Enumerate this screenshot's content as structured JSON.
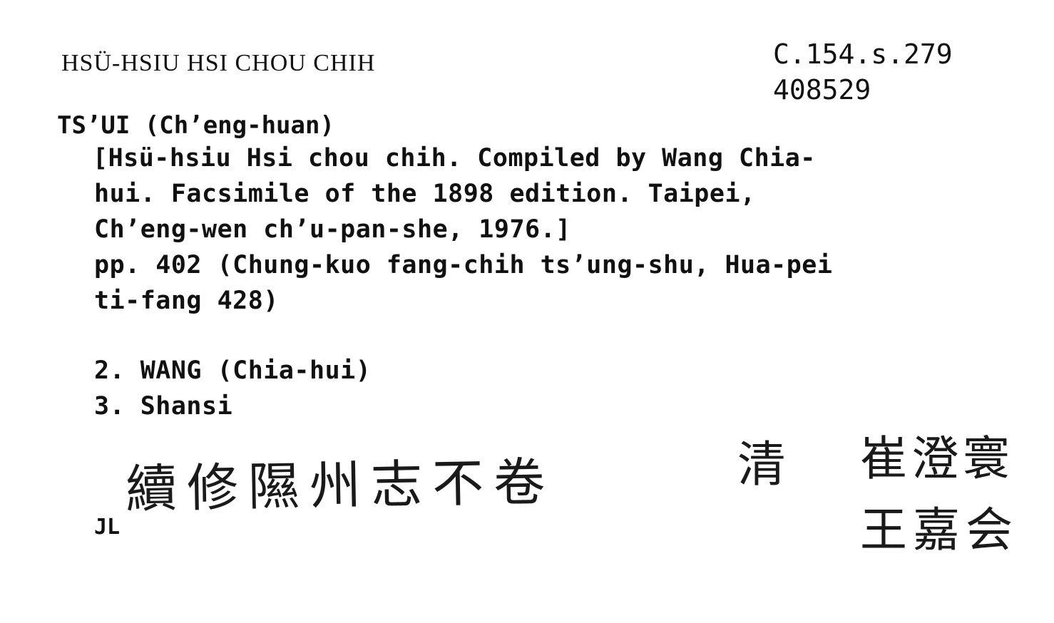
{
  "card": {
    "heading": "HSÜ-HSIU HSI CHOU CHIH",
    "shelfmark": "C.154.s.279",
    "accession": "408529",
    "author": "TS’UI (Ch’eng-huan)",
    "lines": [
      "[Hsü-hsiu Hsi chou chih. Compiled by Wang Chia-",
      "hui. Facsimile of the 1898 edition.  Taipei,",
      "Ch’eng-wen ch’u-pan-she, 1976.]",
      "pp. 402 (Chung-kuo fang-chih ts’ung-shu, Hua-pei",
      "ti-fang 428)"
    ],
    "added_entries": [
      "2. WANG (Chia-hui)",
      "3. Shansi"
    ],
    "initials": "JL"
  },
  "handwriting": {
    "title": "續修隰州志不卷",
    "dynasty": "清",
    "author_primary": "崔澄寰",
    "author_secondary": "王嘉会"
  }
}
